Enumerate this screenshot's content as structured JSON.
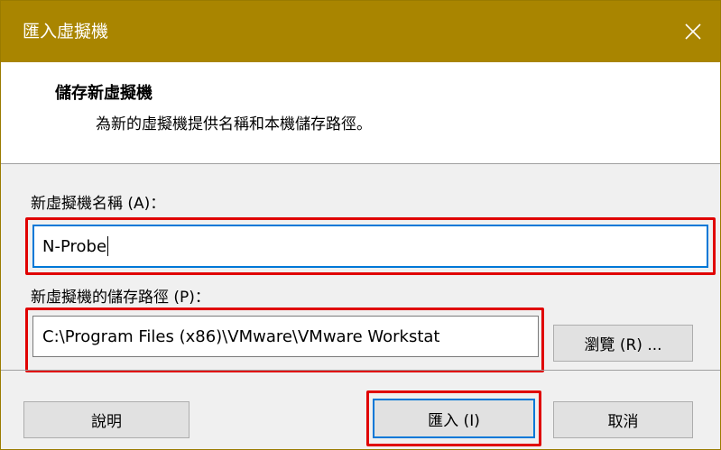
{
  "window": {
    "title": "匯入虛擬機",
    "close_symbol": "✕"
  },
  "header": {
    "title": "儲存新虛擬機",
    "description": "為新的虛擬機提供名稱和本機儲存路徑。"
  },
  "form": {
    "name_label": "新虛擬機名稱 (A)：",
    "name_value": "N-Probe",
    "path_label": "新虛擬機的儲存路徑 (P)：",
    "path_value": "C:\\Program Files (x86)\\VMware\\VMware Workstat",
    "browse_label": "瀏覽 (R) ..."
  },
  "footer": {
    "help_label": "說明",
    "import_label": "匯入 (I)",
    "cancel_label": "取消"
  },
  "colors": {
    "titlebar": "#a98500",
    "highlight": "#e00000",
    "focus": "#0078d7"
  }
}
